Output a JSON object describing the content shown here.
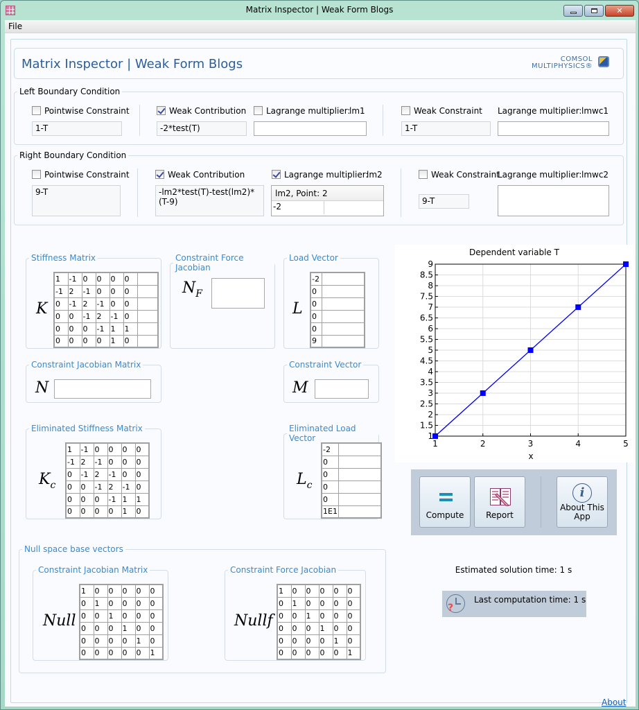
{
  "window": {
    "title": "Matrix Inspector | Weak Form Blogs",
    "menu": [
      "File"
    ]
  },
  "header": {
    "title": "Matrix Inspector | Weak Form Blogs",
    "logo_line1": "COMSOL",
    "logo_line2": "MULTIPHYSICS®"
  },
  "left_bc": {
    "legend": "Left Boundary Condition",
    "pointwise": {
      "label": "Pointwise Constraint",
      "checked": false,
      "value": "1-T"
    },
    "weak_contribution": {
      "label": "Weak Contribution",
      "checked": true,
      "value": "-2*test(T)"
    },
    "lagrange": {
      "label": "Lagrange multiplier:",
      "checked": false,
      "name": "lm1",
      "value": ""
    },
    "weak_constraint": {
      "label": "Weak Constraint",
      "checked": false,
      "value": "1-T"
    },
    "wc_lagrange": {
      "label": "Lagrange multiplier:",
      "name": "lmwc1",
      "value": ""
    }
  },
  "right_bc": {
    "legend": "Right Boundary Condition",
    "pointwise": {
      "label": "Pointwise Constraint",
      "checked": false,
      "value": "9-T"
    },
    "weak_contribution": {
      "label": "Weak Contribution",
      "checked": true,
      "value": "-lm2*test(T)-test(lm2)*(T-9)"
    },
    "lagrange": {
      "label": "Lagrange multiplier:",
      "checked": true,
      "name": "lm2",
      "table_header": "lm2, Point: 2",
      "table_value": "-2"
    },
    "weak_constraint": {
      "label": "Weak Constraint",
      "checked": false,
      "value": "9-T"
    },
    "wc_lagrange": {
      "label": "Lagrange multiplier:",
      "name": "lmwc2",
      "value": ""
    }
  },
  "matrices": {
    "stiffness": {
      "legend": "Stiffness Matrix",
      "symbol": "K",
      "rows": [
        [
          "1",
          "-1",
          "0",
          "0",
          "0",
          "0",
          ""
        ],
        [
          "-1",
          "2",
          "-1",
          "0",
          "0",
          "0",
          ""
        ],
        [
          "0",
          "-1",
          "2",
          "-1",
          "0",
          "0",
          ""
        ],
        [
          "0",
          "0",
          "-1",
          "2",
          "-1",
          "0",
          ""
        ],
        [
          "0",
          "0",
          "0",
          "-1",
          "1",
          "1",
          ""
        ],
        [
          "0",
          "0",
          "0",
          "0",
          "1",
          "0",
          ""
        ]
      ]
    },
    "constraint_force_jacobian": {
      "legend": "Constraint Force Jacobian",
      "symbol": "N",
      "sub": "F"
    },
    "load_vector": {
      "legend": "Load Vector",
      "symbol": "L",
      "rows": [
        [
          "-2",
          ""
        ],
        [
          "0",
          ""
        ],
        [
          "0",
          ""
        ],
        [
          "0",
          ""
        ],
        [
          "0",
          ""
        ],
        [
          "9",
          ""
        ]
      ]
    },
    "constraint_jacobian": {
      "legend": "Constraint Jacobian Matrix",
      "symbol": "N"
    },
    "constraint_vector": {
      "legend": "Constraint Vector",
      "symbol": "M"
    },
    "eliminated_stiffness": {
      "legend": "Eliminated Stiffness Matrix",
      "symbol": "K",
      "sub": "c",
      "rows": [
        [
          "1",
          "-1",
          "0",
          "0",
          "0",
          "0"
        ],
        [
          "-1",
          "2",
          "-1",
          "0",
          "0",
          "0"
        ],
        [
          "0",
          "-1",
          "2",
          "-1",
          "0",
          "0"
        ],
        [
          "0",
          "0",
          "-1",
          "2",
          "-1",
          "0"
        ],
        [
          "0",
          "0",
          "0",
          "-1",
          "1",
          "1"
        ],
        [
          "0",
          "0",
          "0",
          "0",
          "1",
          "0"
        ]
      ]
    },
    "eliminated_load": {
      "legend": "Eliminated Load Vector",
      "symbol": "L",
      "sub": "c",
      "rows": [
        [
          "-2",
          ""
        ],
        [
          "0",
          ""
        ],
        [
          "0",
          ""
        ],
        [
          "0",
          ""
        ],
        [
          "0",
          ""
        ],
        [
          "1E1",
          ""
        ]
      ]
    }
  },
  "null_space": {
    "legend": "Null space base vectors",
    "null": {
      "legend": "Constraint Jacobian Matrix",
      "symbol": "Null",
      "rows": [
        [
          "1",
          "0",
          "0",
          "0",
          "0",
          "0"
        ],
        [
          "0",
          "1",
          "0",
          "0",
          "0",
          "0"
        ],
        [
          "0",
          "0",
          "1",
          "0",
          "0",
          "0"
        ],
        [
          "0",
          "0",
          "0",
          "1",
          "0",
          "0"
        ],
        [
          "0",
          "0",
          "0",
          "0",
          "1",
          "0"
        ],
        [
          "0",
          "0",
          "0",
          "0",
          "0",
          "1"
        ]
      ]
    },
    "nullf": {
      "legend": "Constraint Force Jacobian",
      "symbol": "Nullf",
      "rows": [
        [
          "1",
          "0",
          "0",
          "0",
          "0",
          "0"
        ],
        [
          "0",
          "1",
          "0",
          "0",
          "0",
          "0"
        ],
        [
          "0",
          "0",
          "1",
          "0",
          "0",
          "0"
        ],
        [
          "0",
          "0",
          "0",
          "1",
          "0",
          "0"
        ],
        [
          "0",
          "0",
          "0",
          "0",
          "1",
          "0"
        ],
        [
          "0",
          "0",
          "0",
          "0",
          "0",
          "1"
        ]
      ]
    }
  },
  "chart_data": {
    "type": "line",
    "title": "Dependent variable T",
    "xlabel": "x",
    "ylabel": "",
    "x": [
      1,
      2,
      3,
      4,
      5
    ],
    "series": [
      {
        "name": "T",
        "values": [
          1,
          3,
          5,
          7,
          9
        ],
        "color": "#0000ff",
        "marker": "square"
      }
    ],
    "xlim": [
      1,
      5
    ],
    "ylim": [
      1,
      9
    ],
    "xticks": [
      "1",
      "2",
      "3",
      "4",
      "5"
    ],
    "yticks": [
      "1",
      "1.5",
      "2",
      "2.5",
      "3",
      "3.5",
      "4",
      "4.5",
      "5",
      "5.5",
      "6",
      "6.5",
      "7",
      "7.5",
      "8",
      "8.5",
      "9"
    ],
    "grid": true
  },
  "toolbar": {
    "compute": "Compute",
    "report": "Report",
    "about_line1": "About This",
    "about_line2": "App"
  },
  "status": {
    "estimated": "Estimated solution time: 1 s",
    "last": "Last computation time: 1 s"
  },
  "footer": {
    "about_link": "About"
  },
  "colors": {
    "accent": "#3a8ad0",
    "title": "#2c5e9c",
    "toolbar_bg": "#c0ccda",
    "series": "#0000ff"
  }
}
